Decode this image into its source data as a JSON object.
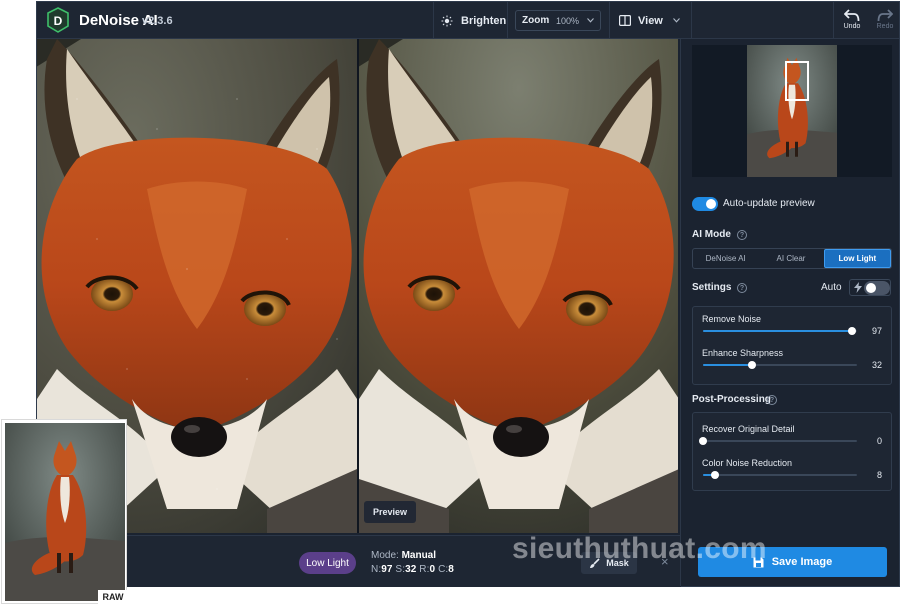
{
  "app": {
    "title": "DeNoise AI",
    "version": "v2.3.6"
  },
  "toolbar": {
    "brighten_label": "Brighten",
    "zoom_label": "Zoom",
    "zoom_value": "100%",
    "view_label": "View",
    "undo_label": "Undo",
    "redo_label": "Redo"
  },
  "canvas": {
    "preview_label": "Preview"
  },
  "statusbar": {
    "mode_pill": "Low Light",
    "mode_label": "Mode:",
    "mode_value": "Manual",
    "n_label": "N:",
    "n_value": "97",
    "s_label": "S:",
    "s_value": "32",
    "r_label": "R:",
    "r_value": "0",
    "c_label": "C:",
    "c_value": "8",
    "mask_label": "Mask",
    "close_glyph": "×"
  },
  "panel": {
    "auto_update_label": "Auto-update preview",
    "auto_update_on": true,
    "ai_mode_label": "AI Mode",
    "ai_modes": [
      "DeNoise AI",
      "AI Clear",
      "Low Light"
    ],
    "ai_mode_selected": "Low Light",
    "settings_label": "Settings",
    "auto_label": "Auto",
    "auto_on": false,
    "settings_sliders": [
      {
        "label": "Remove Noise",
        "value": 97
      },
      {
        "label": "Enhance Sharpness",
        "value": 32
      }
    ],
    "post_processing_label": "Post-Processing",
    "post_sliders": [
      {
        "label": "Recover Original Detail",
        "value": 0
      },
      {
        "label": "Color Noise Reduction",
        "value": 8
      }
    ],
    "save_label": "Save Image"
  },
  "overlay": {
    "raw_label": "RAW",
    "watermark": "sieuthuthuat.com"
  },
  "colors": {
    "accent": "#1f8ae3",
    "pill": "#5b3f8a",
    "background": "#1b2330"
  }
}
